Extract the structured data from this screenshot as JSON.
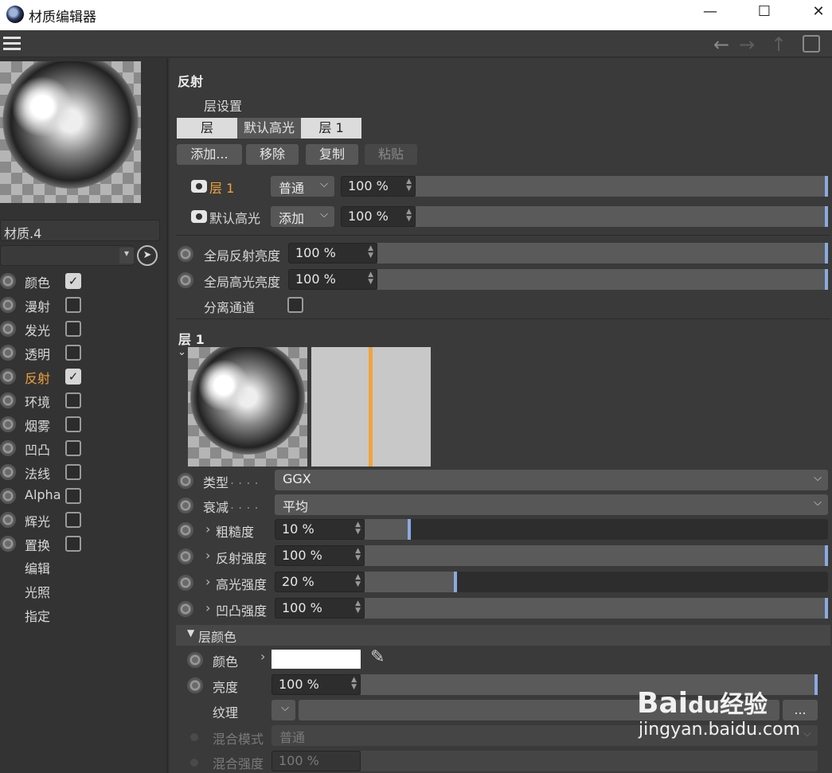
{
  "window": {
    "title": "材质编辑器",
    "minimize": "—",
    "maximize": "☐",
    "close": "✕"
  },
  "toolbar": {
    "back": "←",
    "forward": "→",
    "up": "↑",
    "lock": "🔒"
  },
  "left": {
    "material_name": "材质.4",
    "channels": [
      {
        "label": "颜色",
        "checked": true,
        "active": false
      },
      {
        "label": "漫射",
        "checked": false,
        "active": false
      },
      {
        "label": "发光",
        "checked": false,
        "active": false
      },
      {
        "label": "透明",
        "checked": false,
        "active": false
      },
      {
        "label": "反射",
        "checked": true,
        "active": true
      },
      {
        "label": "环境",
        "checked": false,
        "active": false
      },
      {
        "label": "烟雾",
        "checked": false,
        "active": false
      },
      {
        "label": "凹凸",
        "checked": false,
        "active": false
      },
      {
        "label": "法线",
        "checked": false,
        "active": false
      },
      {
        "label": "Alpha",
        "checked": false,
        "active": false
      },
      {
        "label": "辉光",
        "checked": false,
        "active": false
      },
      {
        "label": "置换",
        "checked": false,
        "active": false
      }
    ],
    "extra": [
      "编辑",
      "光照",
      "指定"
    ]
  },
  "reflect": {
    "title": "反射",
    "layer_settings": "层设置",
    "tabs": [
      "层",
      "默认高光",
      "层 1"
    ],
    "buttons": {
      "add": "添加...",
      "remove": "移除",
      "copy": "复制",
      "paste": "粘贴"
    },
    "layers": [
      {
        "name": "层 1",
        "mode": "普通",
        "value": "100 %",
        "level": 1.0
      },
      {
        "name": "默认高光",
        "mode": "添加",
        "value": "100 %",
        "level": 1.0
      }
    ],
    "global_reflect": {
      "label": "全局反射亮度",
      "value": "100 %",
      "level": 1.0
    },
    "global_spec": {
      "label": "全局高光亮度",
      "value": "100 %",
      "level": 1.0
    },
    "separate": {
      "label": "分离通道",
      "checked": false
    }
  },
  "layer1": {
    "title": "层 1",
    "type": {
      "label": "类型",
      "value": "GGX"
    },
    "falloff": {
      "label": "衰减",
      "value": "平均"
    },
    "roughness": {
      "label": "粗糙度",
      "value": "10 %",
      "level": 0.1
    },
    "reflect_strength": {
      "label": "反射强度",
      "value": "100 %",
      "level": 1.0
    },
    "spec_strength": {
      "label": "高光强度",
      "value": "20 %",
      "level": 0.2
    },
    "bump_strength": {
      "label": "凹凸强度",
      "value": "100 %",
      "level": 1.0
    },
    "color_section": "层颜色",
    "color": {
      "label": "颜色",
      "swatch": "#ffffff"
    },
    "brightness": {
      "label": "亮度",
      "value": "100 %",
      "level": 1.0
    },
    "texture": {
      "label": "纹理",
      "more": "..."
    },
    "blend_mode": {
      "label": "混合模式",
      "value": "普通"
    },
    "blend_strength": {
      "label": "混合强度",
      "value": "100 %"
    }
  },
  "watermark": {
    "brand": "Bai",
    "brand2": "du",
    "brand3": "经验",
    "url": "jingyan.baidu.com"
  },
  "colors": {
    "accent": "#f0a33c",
    "knob": "#8aaae0"
  }
}
